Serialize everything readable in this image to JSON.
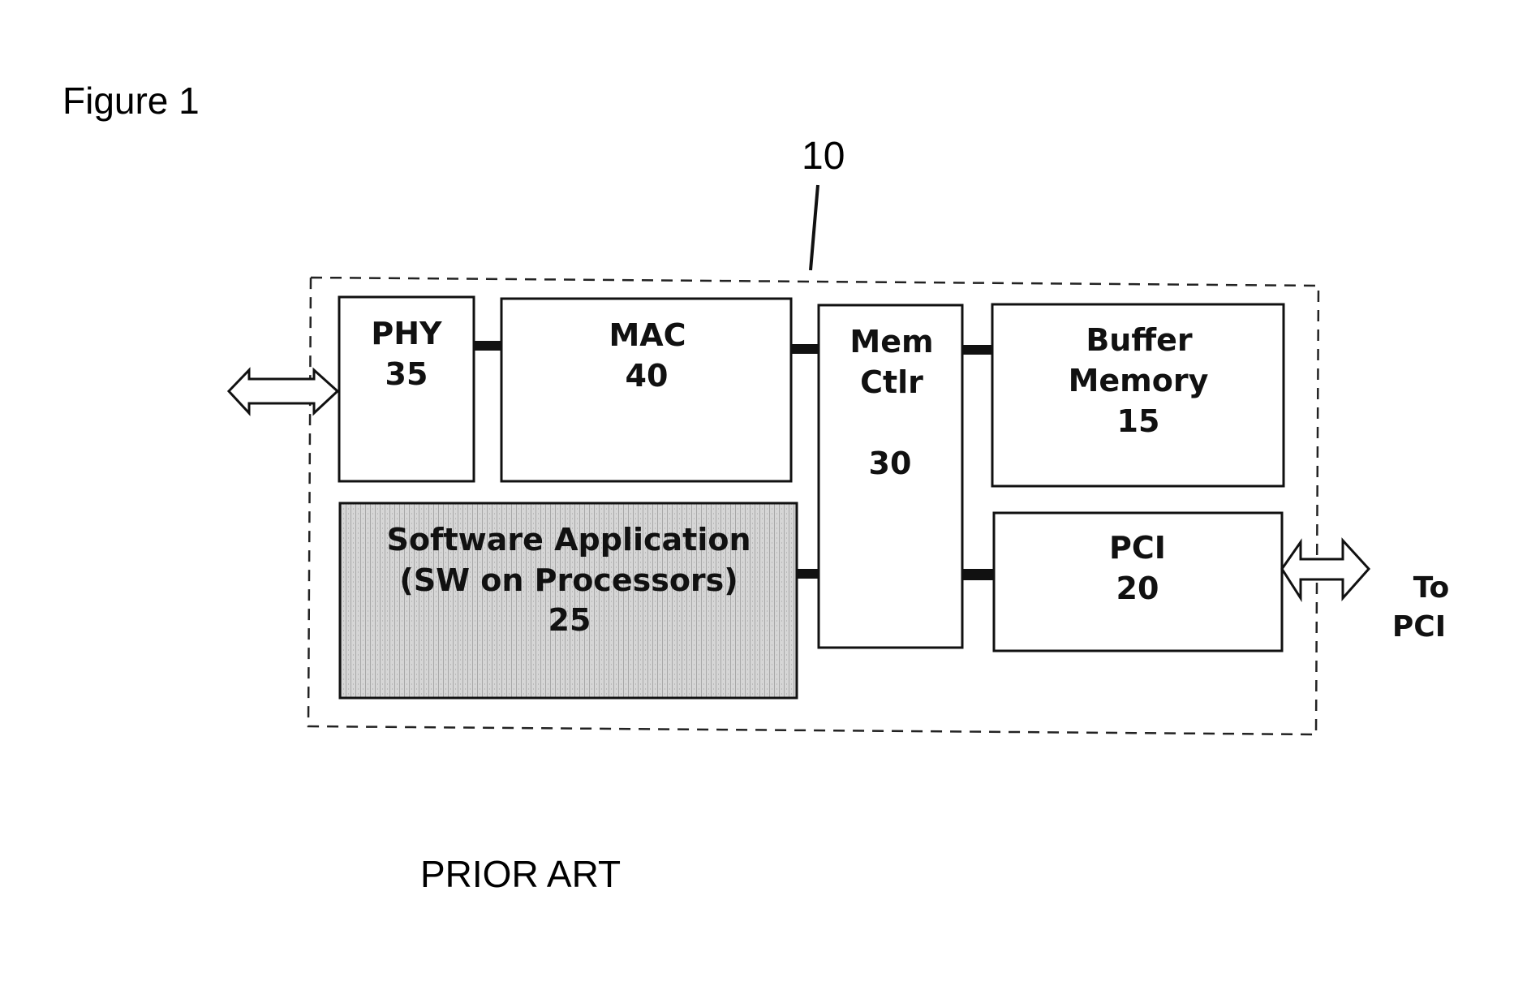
{
  "figure": {
    "title": "Figure 1",
    "caption": "PRIOR ART",
    "reference_numeral": "10"
  },
  "blocks": {
    "phy": {
      "name": "PHY",
      "numeral": "35"
    },
    "mac": {
      "name": "MAC",
      "numeral": "40"
    },
    "mem_ctlr": {
      "line1": "Mem",
      "line2": "Ctlr",
      "numeral": "30"
    },
    "buffer_memory": {
      "line1": "Buffer",
      "line2": "Memory",
      "numeral": "15"
    },
    "pci": {
      "name": "PCI",
      "numeral": "20"
    },
    "software_application": {
      "line1": "Software Application",
      "line2": "(SW on Processors)",
      "numeral": "25"
    }
  },
  "external": {
    "pci_label_line1": "To",
    "pci_label_line2": "PCI"
  },
  "connections": [
    {
      "from": "PHY",
      "to": "MAC"
    },
    {
      "from": "MAC",
      "to": "Mem Ctlr"
    },
    {
      "from": "Mem Ctlr",
      "to": "Buffer Memory"
    },
    {
      "from": "Software Application",
      "to": "Mem Ctlr"
    },
    {
      "from": "Mem Ctlr",
      "to": "PCI"
    },
    {
      "from": "external network",
      "to": "PHY",
      "bidirectional": true
    },
    {
      "from": "PCI",
      "to": "To PCI",
      "bidirectional": true
    }
  ],
  "colors": {
    "ink": "#111111",
    "shaded_block": "#c8c8c8",
    "background": "#ffffff"
  }
}
